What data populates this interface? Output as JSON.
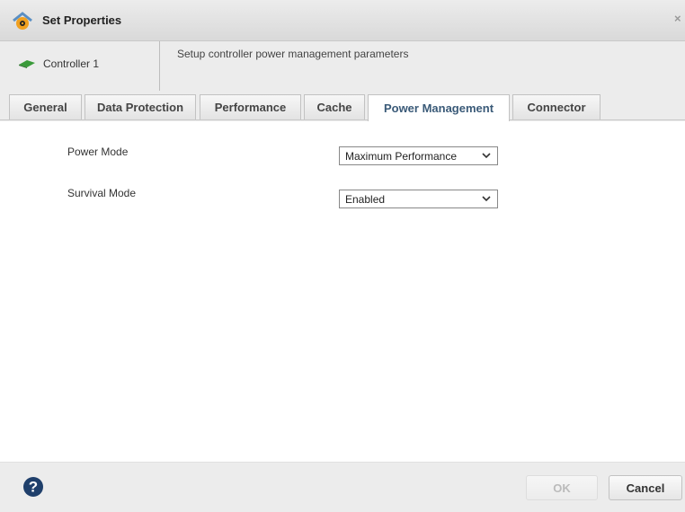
{
  "dialog": {
    "title": "Set Properties",
    "close_glyph": "×",
    "title_icon": "gear-properties-icon"
  },
  "subheader": {
    "controller_label": "Controller 1",
    "controller_icon": "controller-card-icon",
    "description": "Setup controller power management parameters"
  },
  "tabs": [
    {
      "label": "General",
      "active": false
    },
    {
      "label": "Data Protection",
      "active": false
    },
    {
      "label": "Performance",
      "active": false
    },
    {
      "label": "Cache",
      "active": false
    },
    {
      "label": "Power Management",
      "active": true
    },
    {
      "label": "Connector",
      "active": false
    }
  ],
  "form": {
    "power_mode": {
      "label": "Power Mode",
      "value": "Maximum Performance"
    },
    "survival_mode": {
      "label": "Survival Mode",
      "value": "Enabled"
    }
  },
  "footer": {
    "help_icon": "help-icon",
    "ok_label": "OK",
    "cancel_label": "Cancel"
  },
  "colors": {
    "active_tab_text": "#3a5a78",
    "help_icon_bg": "#1f3f6b",
    "controller_icon": "#3a9a3a"
  }
}
